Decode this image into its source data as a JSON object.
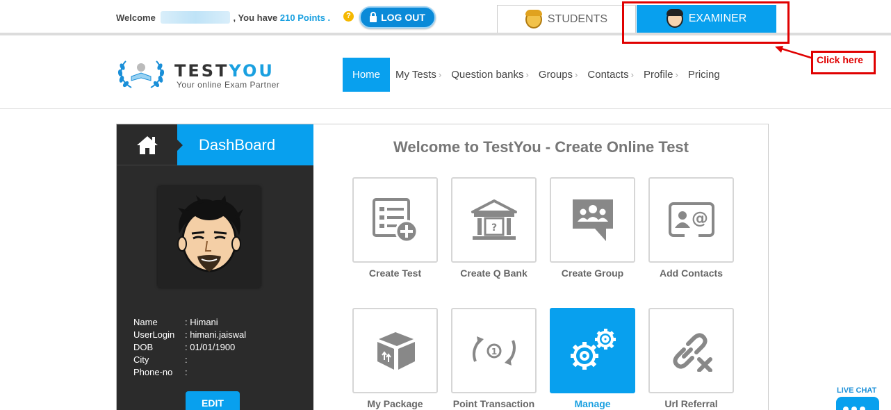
{
  "topbar": {
    "welcome_prefix": "Welcome",
    "welcome_middle": ", You have",
    "points": "210 Points .",
    "help_glyph": "?",
    "logout_label": "LOG OUT",
    "tabs": [
      {
        "label": "STUDENTS",
        "active": false
      },
      {
        "label": "EXAMINER",
        "active": true
      }
    ]
  },
  "annotation": {
    "callout_text": "Click here",
    "color": "#e00000"
  },
  "header": {
    "logo_main": "TEST",
    "logo_accent": "YOU",
    "logo_tagline": "Your online Exam Partner",
    "nav": [
      {
        "label": "Home",
        "active": true,
        "chevron": ""
      },
      {
        "label": "My Tests",
        "active": false,
        "chevron": "›"
      },
      {
        "label": "Question banks",
        "active": false,
        "chevron": "›"
      },
      {
        "label": "Groups",
        "active": false,
        "chevron": "›"
      },
      {
        "label": "Contacts",
        "active": false,
        "chevron": "›"
      },
      {
        "label": "Profile",
        "active": false,
        "chevron": "›"
      },
      {
        "label": "Pricing",
        "active": false,
        "chevron": ""
      }
    ]
  },
  "sidebar": {
    "title": "DashBoard",
    "profile": [
      {
        "key": "Name",
        "value": ": Himani"
      },
      {
        "key": "UserLogin",
        "value": ": himani.jaiswal"
      },
      {
        "key": "DOB",
        "value": ": 01/01/1900"
      },
      {
        "key": "City",
        "value": ":"
      },
      {
        "key": "Phone-no",
        "value": ":"
      }
    ],
    "edit_label": "EDIT"
  },
  "main": {
    "title": "Welcome to TestYou - Create Online Test",
    "tiles": [
      {
        "label": "Create Test",
        "icon": "create-test-icon",
        "active": false
      },
      {
        "label": "Create Q Bank",
        "icon": "question-bank-icon",
        "active": false
      },
      {
        "label": "Create Group",
        "icon": "group-icon",
        "active": false
      },
      {
        "label": "Add Contacts",
        "icon": "contact-card-icon",
        "active": false
      },
      {
        "label": "My Package",
        "icon": "package-box-icon",
        "active": false
      },
      {
        "label": "Point Transaction",
        "icon": "point-transaction-icon",
        "active": false
      },
      {
        "label": "Manage",
        "icon": "gears-icon",
        "active": true
      },
      {
        "label": "Url Referral",
        "icon": "broken-link-icon",
        "active": false
      }
    ]
  },
  "livechat": {
    "label": "LIVE CHAT"
  },
  "colors": {
    "accent": "#08a0ee",
    "sidebar_bg": "#2b2b2b",
    "annotation_red": "#e00000"
  }
}
